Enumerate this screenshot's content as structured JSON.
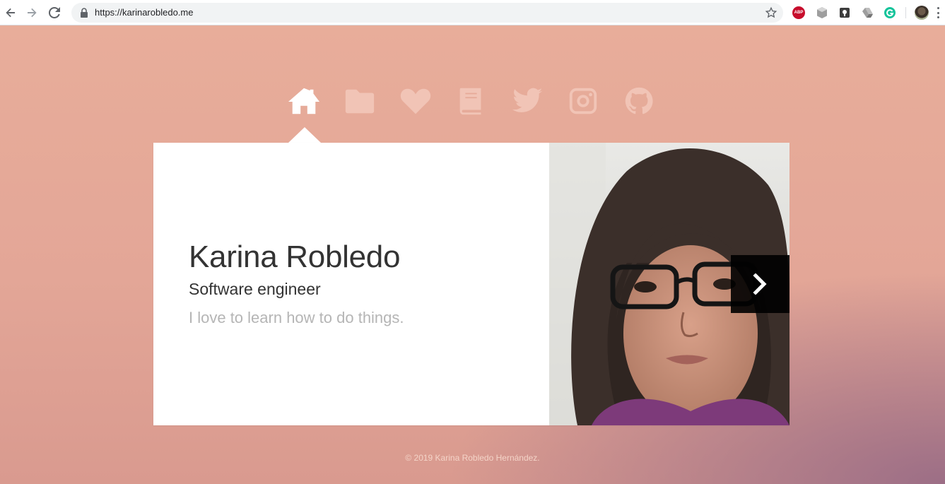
{
  "browser": {
    "url": "https://karinarobledo.me",
    "extensions": [
      "adblock-plus-icon",
      "shield-extension-icon",
      "keeper-extension-icon",
      "google-drive-icon",
      "grammarly-icon"
    ],
    "abp_label": "ABP"
  },
  "nav": {
    "items": [
      {
        "name": "home",
        "icon": "home-icon",
        "active": true
      },
      {
        "name": "portfolio",
        "icon": "folder-icon",
        "active": false
      },
      {
        "name": "likes",
        "icon": "heart-icon",
        "active": false
      },
      {
        "name": "blog",
        "icon": "book-icon",
        "active": false
      },
      {
        "name": "twitter",
        "icon": "twitter-icon",
        "active": false
      },
      {
        "name": "instagram",
        "icon": "instagram-icon",
        "active": false
      },
      {
        "name": "github",
        "icon": "github-icon",
        "active": false
      }
    ]
  },
  "profile": {
    "name": "Karina Robledo",
    "title": "Software engineer",
    "tagline": "I love to learn how to do things."
  },
  "carousel": {
    "next_icon": "chevron-right-icon"
  },
  "footer": {
    "copyright": "© 2019 Karina Robledo Hernández."
  },
  "colors": {
    "background": "#e8ad9a",
    "card": "#ffffff",
    "nav_icon_dim": "#f3c9bc",
    "nav_icon_active": "#ffffff"
  }
}
